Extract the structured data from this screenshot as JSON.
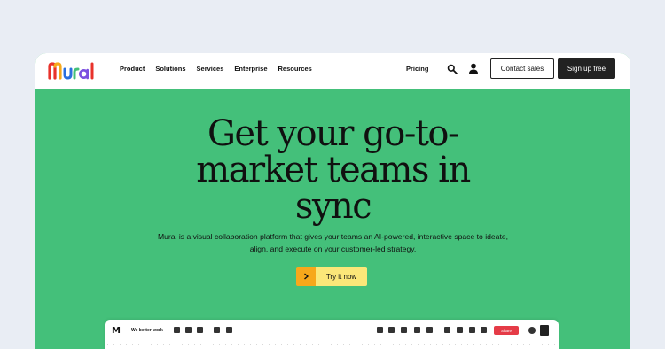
{
  "nav": {
    "logo_text": "Mural",
    "links": [
      "Product",
      "Solutions",
      "Services",
      "Enterprise",
      "Resources"
    ],
    "pricing": "Pricing",
    "contact_sales": "Contact sales",
    "sign_up": "Sign up free"
  },
  "hero": {
    "headline_lines": [
      "Get your go-to-",
      "market teams in",
      "sync"
    ],
    "subtitle": "Mural is a visual collaboration platform that gives your teams an AI-powered, interactive space to ideate, align, and execute on your customer-led strategy.",
    "cta_label": "Try it now",
    "cta_icon": "chevron-right-icon"
  },
  "preview": {
    "logo_text": "M",
    "board_title": "We better work",
    "share_label": "Share"
  },
  "colors": {
    "hero_bg": "#44c07a",
    "page_bg": "#e9edf4",
    "cta_arrow": "#f7a81b",
    "cta_label_bg": "#fbe779",
    "signup_bg": "#222222",
    "share_bg": "#e53b47",
    "logo_colors": [
      "#e8322b",
      "#f7a81b",
      "#2b6fde",
      "#44c07a",
      "#7b4fe0"
    ]
  }
}
